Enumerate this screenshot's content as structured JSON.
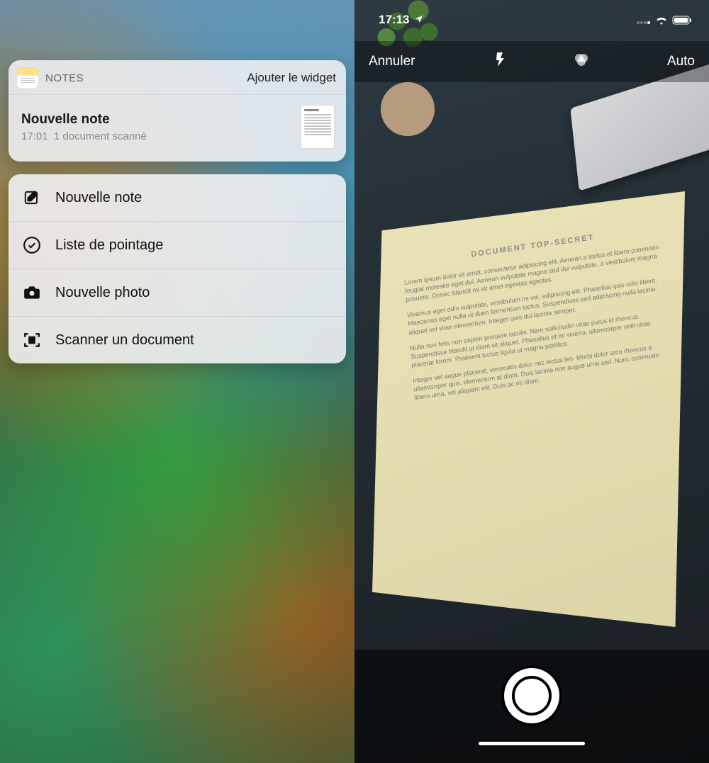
{
  "left": {
    "widget": {
      "app_name": "NOTES",
      "add_widget_label": "Ajouter le widget",
      "note_title": "Nouvelle note",
      "note_time": "17:01",
      "note_subtitle": "1 document scanné"
    },
    "actions": [
      {
        "icon": "compose-icon",
        "label": "Nouvelle note"
      },
      {
        "icon": "checklist-icon",
        "label": "Liste de pointage"
      },
      {
        "icon": "camera-icon",
        "label": "Nouvelle photo"
      },
      {
        "icon": "scan-icon",
        "label": "Scanner un document"
      }
    ]
  },
  "right": {
    "status_time": "17:13",
    "toolbar": {
      "cancel_label": "Annuler",
      "mode_label": "Auto"
    },
    "document_heading": "DOCUMENT TOP-SECRET"
  }
}
